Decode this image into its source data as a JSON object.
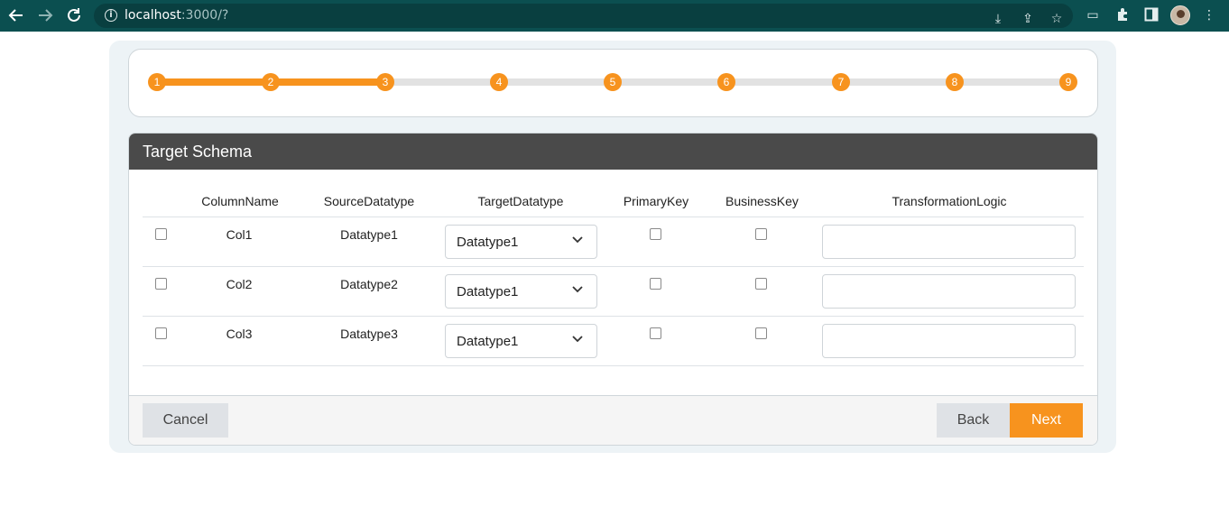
{
  "browser": {
    "url_host": "localhost",
    "url_path": ":3000/?",
    "accent": "#0b4f50"
  },
  "stepper": {
    "steps": [
      "1",
      "2",
      "3",
      "4",
      "5",
      "6",
      "7",
      "8",
      "9"
    ],
    "current_step": 3,
    "progress_fraction": 0.25,
    "accent": "#f7931e"
  },
  "panel": {
    "title": "Target Schema",
    "columns": {
      "column_name": "ColumnName",
      "source_datatype": "SourceDatatype",
      "target_datatype": "TargetDatatype",
      "primary_key": "PrimaryKey",
      "business_key": "BusinessKey",
      "transformation_logic": "TransformationLogic"
    },
    "rows": [
      {
        "column_name": "Col1",
        "source_datatype": "Datatype1",
        "target_datatype": "Datatype1",
        "selected": false,
        "primary_key": false,
        "business_key": false,
        "transformation_logic": ""
      },
      {
        "column_name": "Col2",
        "source_datatype": "Datatype2",
        "target_datatype": "Datatype1",
        "selected": false,
        "primary_key": false,
        "business_key": false,
        "transformation_logic": ""
      },
      {
        "column_name": "Col3",
        "source_datatype": "Datatype3",
        "target_datatype": "Datatype1",
        "selected": false,
        "primary_key": false,
        "business_key": false,
        "transformation_logic": ""
      }
    ]
  },
  "footer": {
    "cancel_label": "Cancel",
    "back_label": "Back",
    "next_label": "Next"
  }
}
